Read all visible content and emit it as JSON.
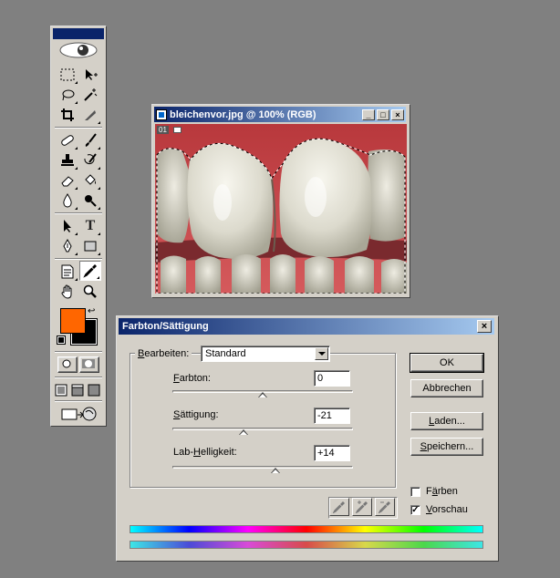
{
  "image_window": {
    "title": "bleichenvor.jpg @ 100% (RGB)",
    "doc_badge": "01",
    "minimize_label": "_",
    "maximize_label": "□",
    "close_label": "×"
  },
  "toolbox": {
    "foreground_color": "#ff6600",
    "background_color": "#000000",
    "type_tool_label": "T"
  },
  "dialog": {
    "title": "Farbton/Sättigung",
    "close_label": "×",
    "edit_label_u": "B",
    "edit_label_rest": "earbeiten:",
    "edit_value": "Standard",
    "hue": {
      "label_u": "F",
      "label_rest": "arbton:",
      "value": "0",
      "position": 0.5
    },
    "saturation": {
      "label_u": "S",
      "label_rest": "ättigung:",
      "value": "-21",
      "position": 0.395
    },
    "lightness": {
      "label_pre": "Lab-",
      "label_u": "H",
      "label_rest": "elligkeit:",
      "value": "+14",
      "position": 0.57
    },
    "buttons": {
      "ok": "OK",
      "cancel": "Abbrechen",
      "load_u": "L",
      "load_rest": "aden...",
      "save_u": "S",
      "save_rest": "peichern..."
    },
    "colorize": {
      "label_pre": "F",
      "label_u": "ä",
      "label_rest": "rben",
      "checked": false
    },
    "preview": {
      "label_u": "V",
      "label_rest": "orschau",
      "checked": true,
      "mark": "✓"
    }
  }
}
